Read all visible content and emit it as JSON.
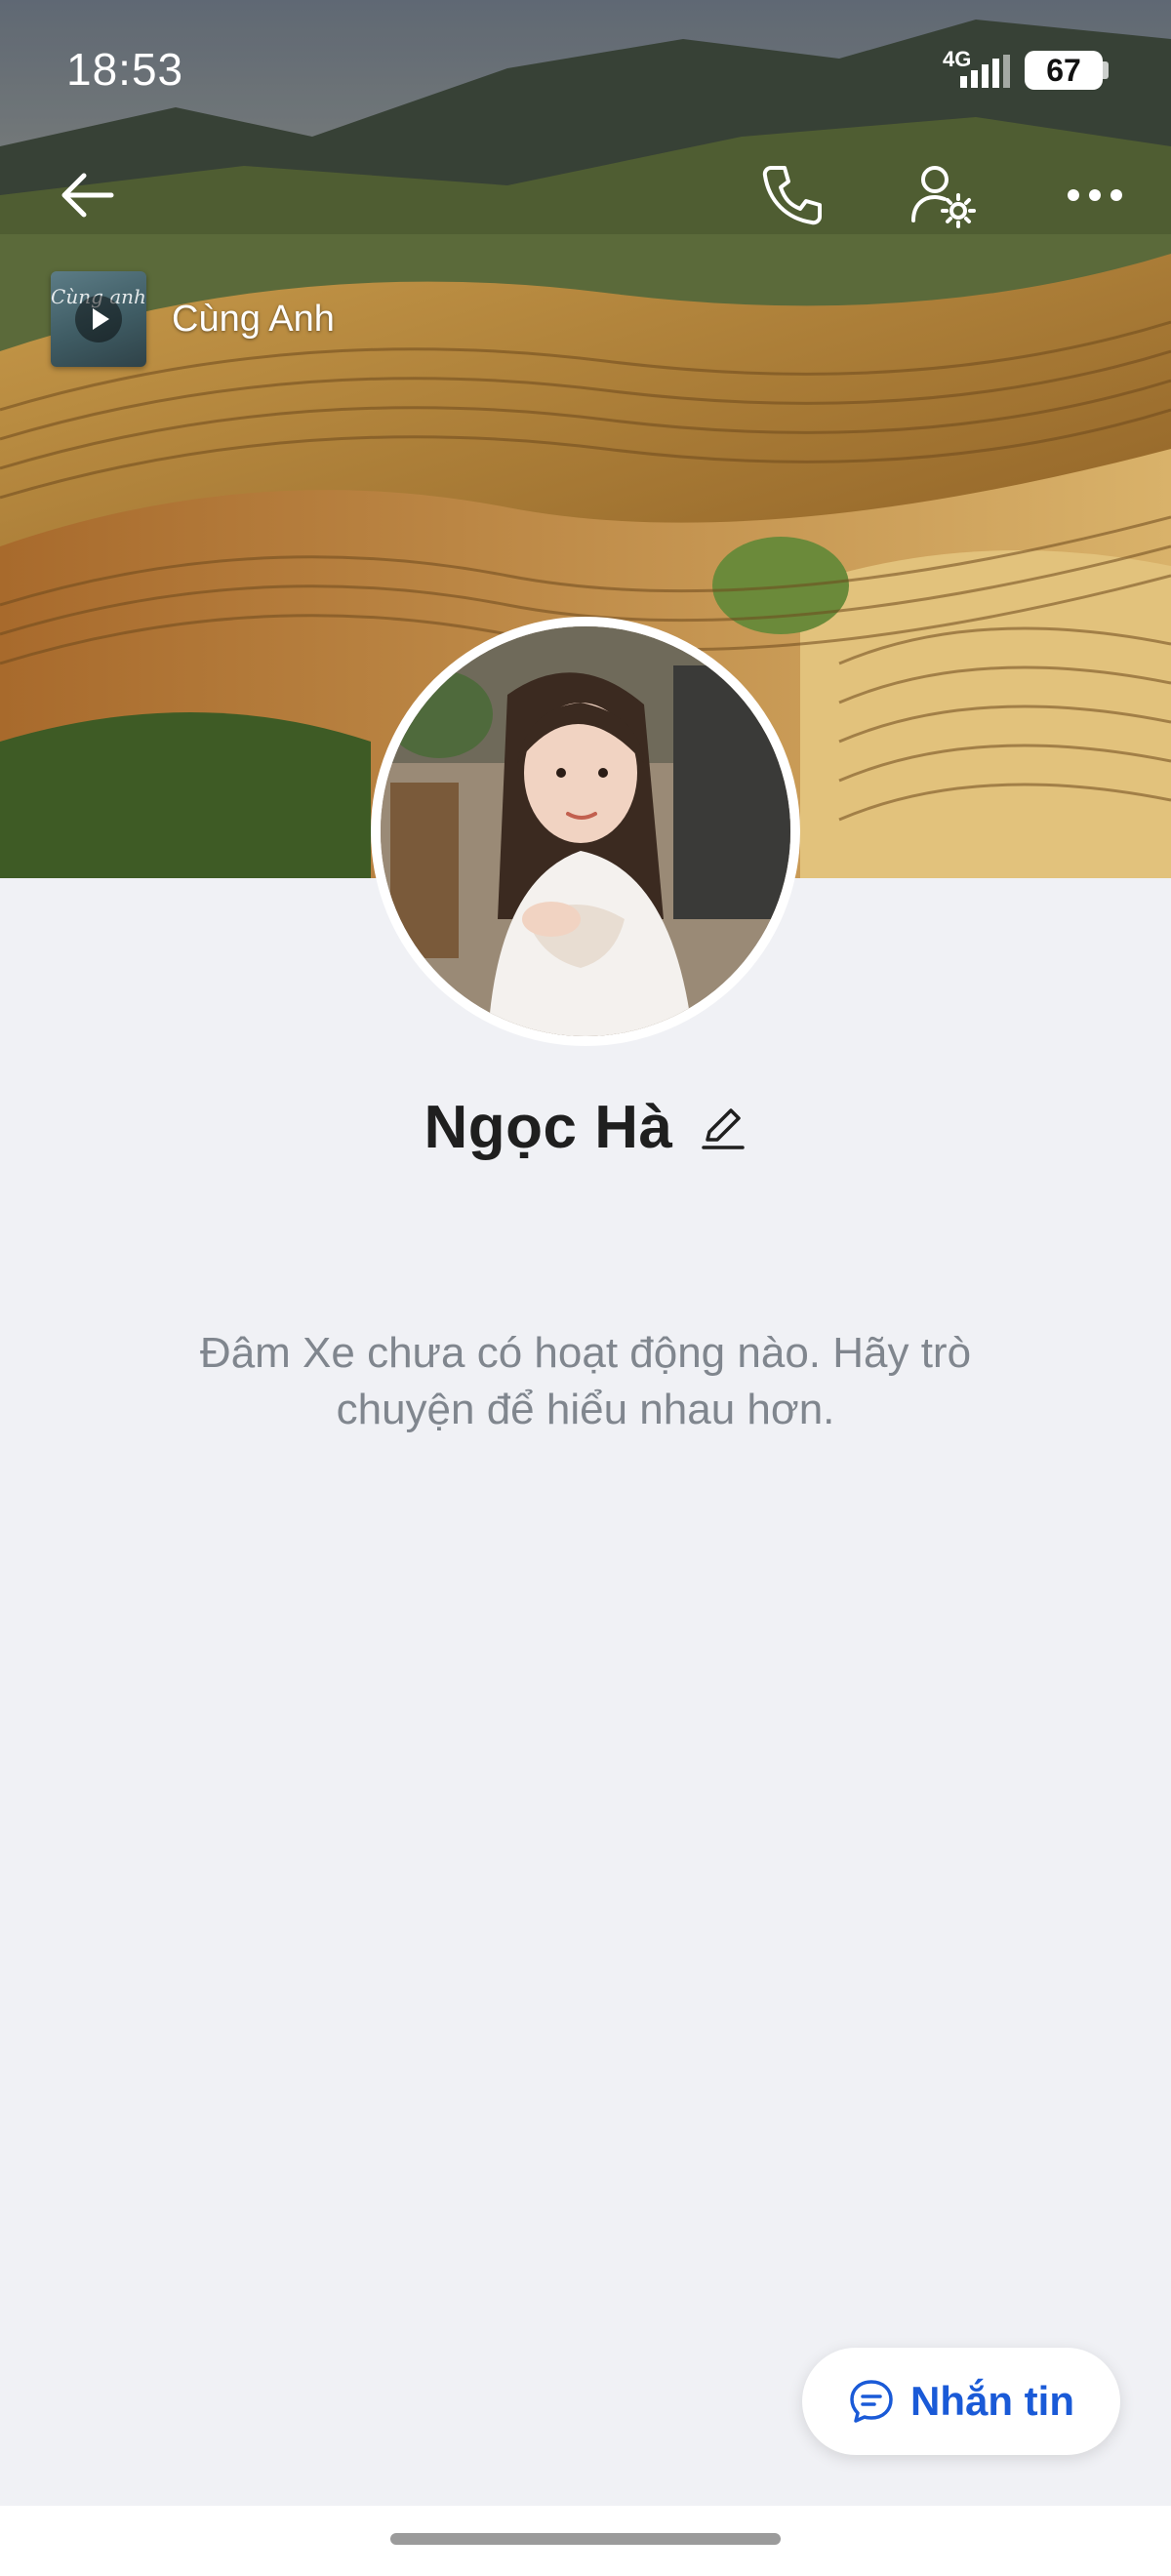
{
  "status_bar": {
    "time": "18:53",
    "network": "4G",
    "battery": "67"
  },
  "nav": {
    "back_icon": "arrow-left-icon",
    "call_icon": "phone-icon",
    "settings_icon": "user-settings-icon",
    "more_icon": "more-horizontal-icon"
  },
  "music": {
    "title": "Cùng Anh",
    "thumb_script": "Cùng anh"
  },
  "profile": {
    "name": "Ngọc Hà",
    "edit_icon": "pencil-icon"
  },
  "empty_state": {
    "text": "Đâm Xe chưa có hoạt động nào. Hãy trò chuyện để hiểu nhau hơn."
  },
  "actions": {
    "message_label": "Nhắn tin",
    "message_icon": "chat-bubble-icon"
  },
  "colors": {
    "accent": "#1a5ad7",
    "background": "#f0f1f5",
    "muted_text": "#80868e"
  }
}
